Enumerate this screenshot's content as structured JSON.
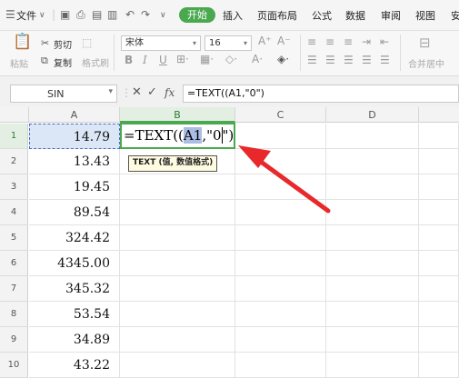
{
  "menubar": {
    "file": "文件",
    "start": "开始",
    "insert": "插入",
    "page_layout": "页面布局",
    "formula": "公式",
    "data": "数据",
    "review": "审阅",
    "view": "视图",
    "security": "安"
  },
  "ribbon": {
    "paste": "粘贴",
    "cut": "剪切",
    "copy": "复制",
    "format_painter": "格式刷",
    "font_name": "宋体",
    "font_size": "16",
    "merge_center": "合并居中",
    "bold": "B",
    "italic": "I",
    "underline": "U"
  },
  "formula_bar": {
    "name_box": "SIN",
    "fx": "fx",
    "formula": "=TEXT((A1,\"0\")"
  },
  "columns": [
    "A",
    "B",
    "C",
    "D"
  ],
  "rows": [
    {
      "num": "1",
      "a": "14.79"
    },
    {
      "num": "2",
      "a": "13.43"
    },
    {
      "num": "3",
      "a": "19.45"
    },
    {
      "num": "4",
      "a": "89.54"
    },
    {
      "num": "5",
      "a": "324.42"
    },
    {
      "num": "6",
      "a": "4345.00"
    },
    {
      "num": "7",
      "a": "345.32"
    },
    {
      "num": "8",
      "a": "53.54"
    },
    {
      "num": "9",
      "a": "34.89"
    },
    {
      "num": "10",
      "a": "43.22"
    }
  ],
  "edit_cell": {
    "prefix": "=TEXT((",
    "ref": "A1",
    "mid": ",\"",
    "zero": "0",
    "suffix": "\")"
  },
  "tooltip": "TEXT (值, 数值格式)",
  "colors": {
    "accent_green": "#4aa84f",
    "arrow_red": "#e8282b",
    "ref_blue": "#aabde4"
  }
}
